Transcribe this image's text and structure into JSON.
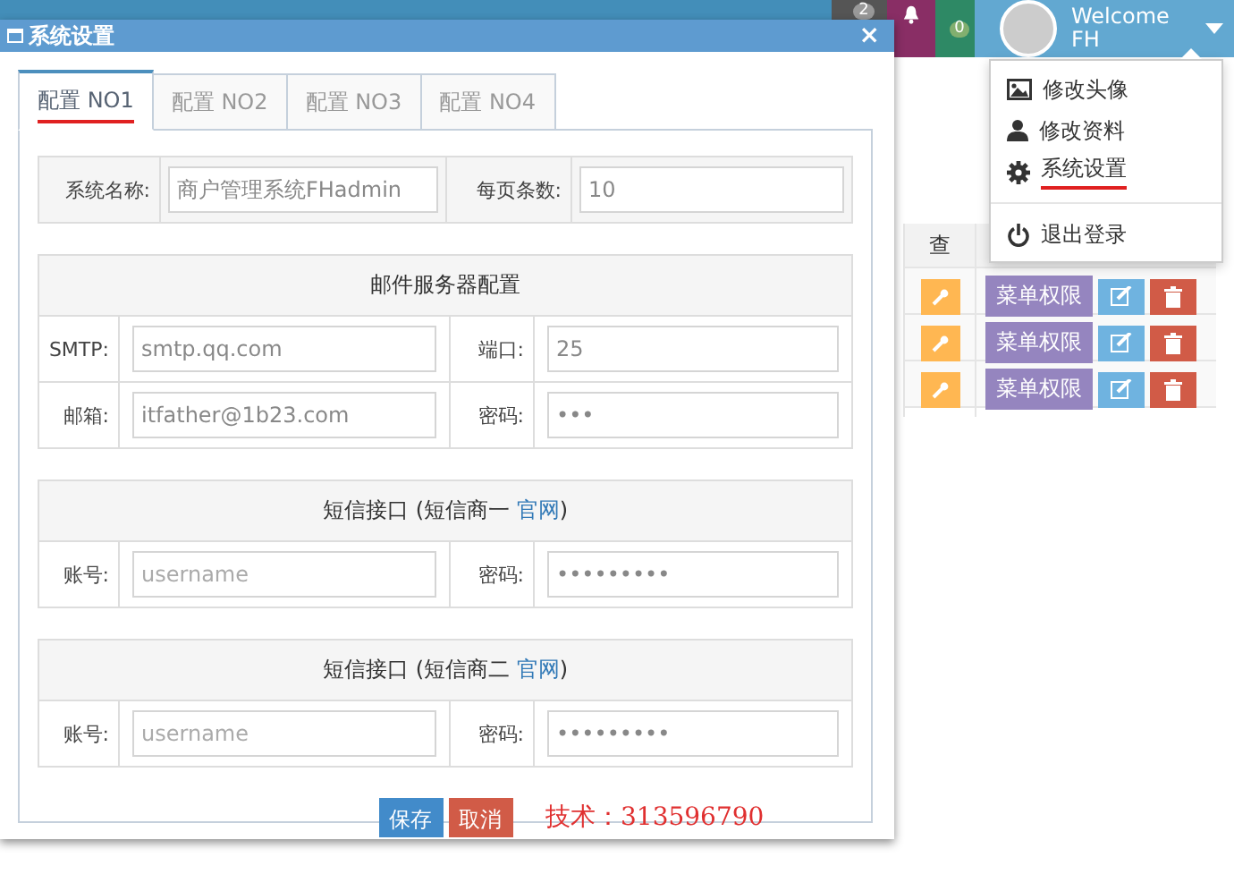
{
  "header": {
    "notifications": [
      {
        "kind": "tasks",
        "count": "2"
      },
      {
        "kind": "bell"
      },
      {
        "kind": "mail",
        "count": "0"
      }
    ],
    "user": {
      "welcome": "Welcome",
      "name": "FH",
      "menu_open": true
    }
  },
  "user_menu": {
    "items": [
      {
        "kind": "picture",
        "label": "修改头像",
        "annotated": false
      },
      {
        "kind": "person",
        "label": "修改资料",
        "annotated": false
      },
      {
        "kind": "gear",
        "label": "系统设置",
        "annotated": true
      },
      {
        "kind": "power",
        "label": "退出登录",
        "annotated": false
      }
    ]
  },
  "background_table": {
    "header": "查",
    "rows": [
      {
        "menu_button": "菜单权限"
      },
      {
        "menu_button": "菜单权限"
      },
      {
        "menu_button": "菜单权限"
      }
    ]
  },
  "dialog": {
    "title": "系统设置",
    "close": "×",
    "tabs": [
      {
        "label": "配置 NO1",
        "selected": true,
        "annotated": true
      },
      {
        "label": "配置 NO2",
        "selected": false,
        "annotated": false
      },
      {
        "label": "配置 NO3",
        "selected": false,
        "annotated": false
      },
      {
        "label": "配置 NO4",
        "selected": false,
        "annotated": false
      }
    ],
    "sections": [
      {
        "kind": "basic",
        "rows": [
          {
            "fields": [
              {
                "label": "系统名称:",
                "value": "商户管理系统FHadmin"
              },
              {
                "label": "每页条数:",
                "value": "10"
              }
            ]
          }
        ]
      },
      {
        "kind": "group",
        "title": "邮件服务器配置",
        "rows": [
          {
            "fields": [
              {
                "label": "SMTP:",
                "value": "smtp.qq.com"
              },
              {
                "label": "端口:",
                "value": "25"
              }
            ]
          },
          {
            "fields": [
              {
                "label": "邮箱:",
                "value": "itfather@1b23.com"
              },
              {
                "label": "密码:",
                "value": "•••"
              }
            ]
          }
        ]
      },
      {
        "kind": "group",
        "title": "短信接口 (短信商一 ",
        "link": "官网",
        "title_end": ")",
        "rows": [
          {
            "fields": [
              {
                "label": "账号:",
                "placeholder": "username"
              },
              {
                "label": "密码:",
                "value": "•••••••••"
              }
            ]
          }
        ]
      },
      {
        "kind": "group",
        "title": "短信接口 (短信商二 ",
        "link": "官网",
        "title_end": ")",
        "rows": [
          {
            "fields": [
              {
                "label": "账号:",
                "placeholder": "username"
              },
              {
                "label": "密码:",
                "value": "•••••••••"
              }
            ]
          }
        ]
      }
    ],
    "buttons": [
      {
        "kind": "primary",
        "label": "保存"
      },
      {
        "kind": "danger",
        "label": "取消"
      }
    ]
  },
  "annotation": "技术：313596790"
}
